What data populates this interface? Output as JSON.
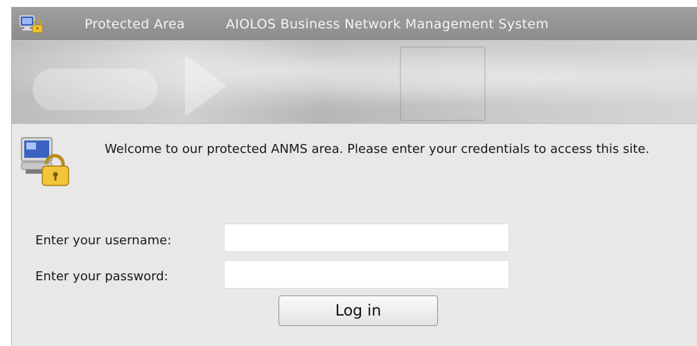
{
  "header": {
    "app_icon": "monitor-lock-icon",
    "area_label": "Protected Area",
    "system_title": "AIOLOS Business Network Management System"
  },
  "banner": {
    "decoration": "network-background-image"
  },
  "intro": {
    "icon": "computer-padlock-icon",
    "message": "Welcome to our protected ANMS area. Please enter your credentials to access this site."
  },
  "login_form": {
    "username_label": "Enter your username:",
    "username_value": "",
    "password_label": "Enter your password:",
    "password_value": "",
    "submit_label": "Log in"
  },
  "colors": {
    "titlebar": "#8c8c8c",
    "title_text": "#f4f4f4",
    "panel_background": "#e8e8e8"
  }
}
